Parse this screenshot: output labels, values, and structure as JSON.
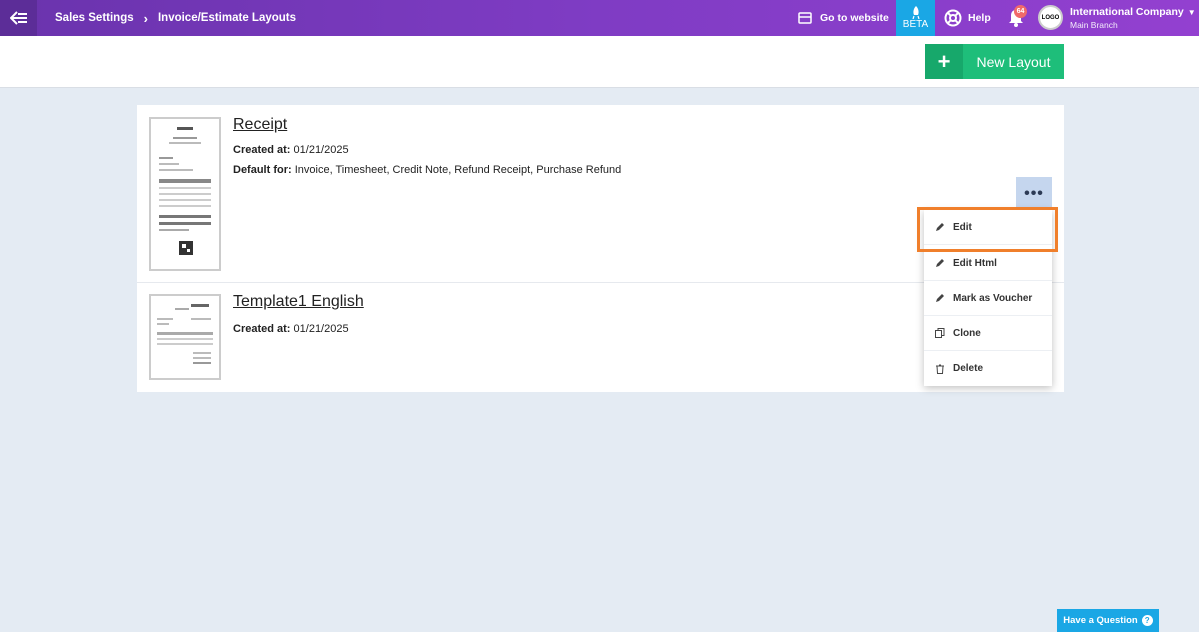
{
  "header": {
    "breadcrumb": [
      "Sales Settings",
      "Invoice/Estimate Layouts"
    ],
    "goto_website": "Go to website",
    "beta": "BETA",
    "help": "Help",
    "notifications_count": "64",
    "company_logo_text": "LOGO",
    "company_name": "International Company",
    "branch": "Main Branch"
  },
  "actions": {
    "new_layout": "New Layout"
  },
  "layouts": [
    {
      "title": "Receipt",
      "created_label": "Created at:",
      "created_value": "01/21/2025",
      "default_label": "Default for:",
      "default_value": "Invoice, Timesheet, Credit Note, Refund Receipt, Purchase Refund"
    },
    {
      "title": "Template1 English",
      "created_label": "Created at:",
      "created_value": "01/21/2025"
    }
  ],
  "menu": {
    "more": "•••",
    "items": [
      "Edit",
      "Edit Html",
      "Mark as Voucher",
      "Clone",
      "Delete"
    ]
  },
  "help_widget": {
    "label": "Have a Question",
    "icon": "?"
  },
  "colors": {
    "header": "#7f3cc4",
    "accent_green": "#1ebe7a",
    "beta": "#1aa7e5",
    "highlight": "#f07f2b"
  }
}
